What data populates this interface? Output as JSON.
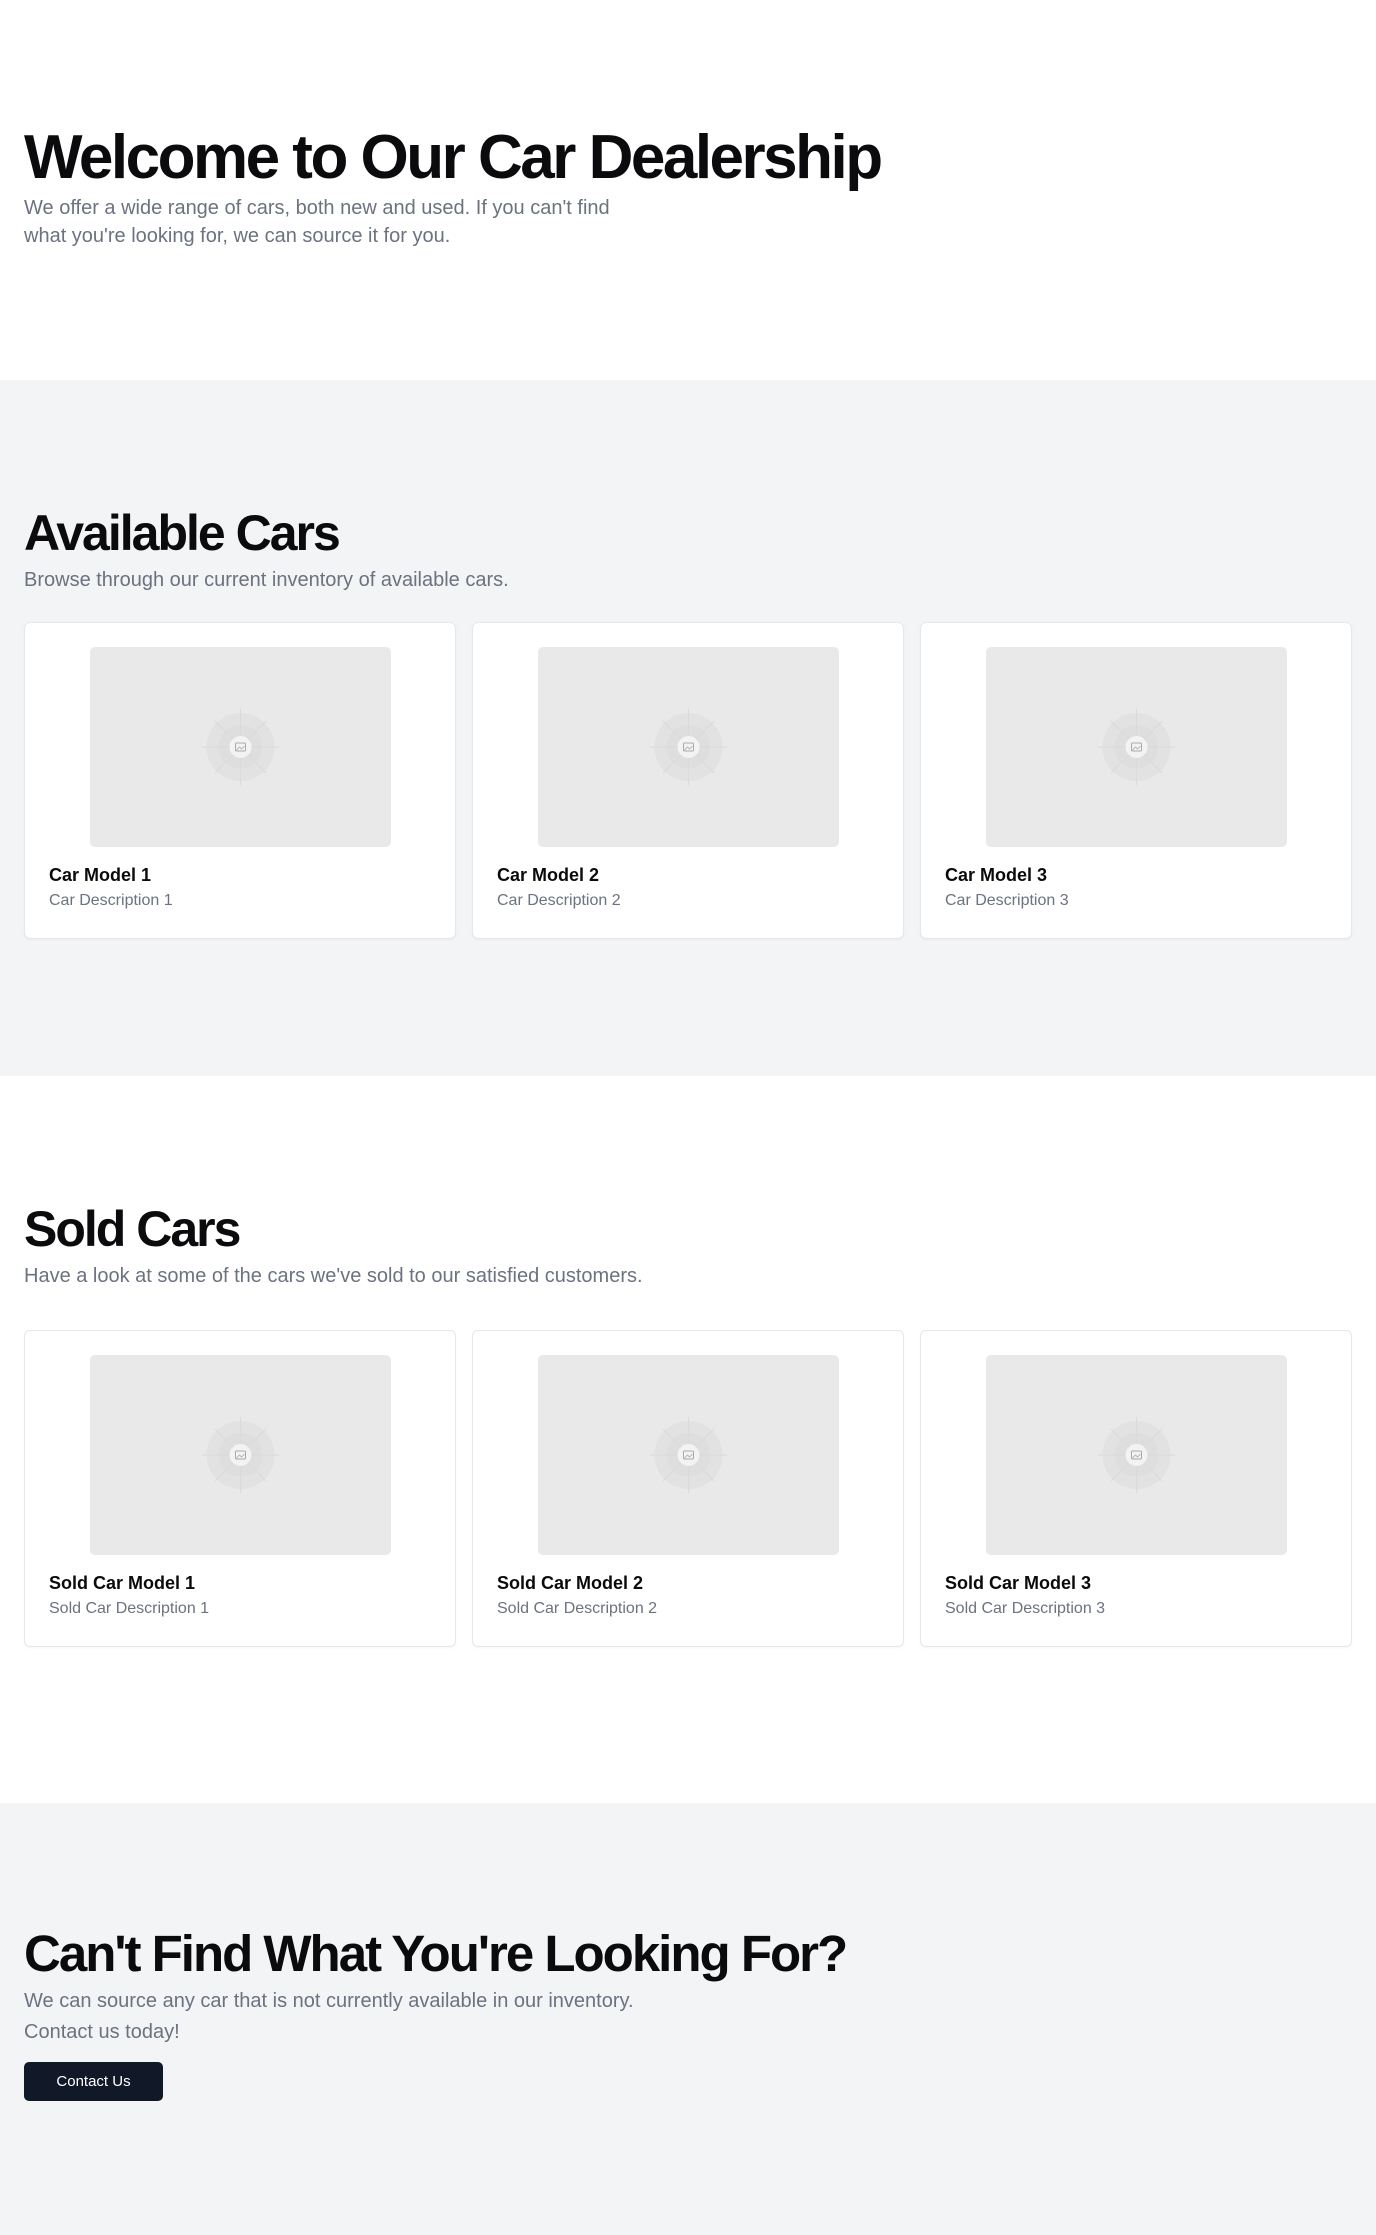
{
  "hero": {
    "title": "Welcome to Our Car Dealership",
    "subtitle": "We offer a wide range of cars, both new and used. If you can't find what you're looking for, we can source it for you."
  },
  "available": {
    "title": "Available Cars",
    "subtitle": "Browse through our current inventory of available cars.",
    "cards": [
      {
        "name": "Car Model 1",
        "desc": "Car Description 1",
        "icon": "image-placeholder-icon"
      },
      {
        "name": "Car Model 2",
        "desc": "Car Description 2",
        "icon": "image-placeholder-icon"
      },
      {
        "name": "Car Model 3",
        "desc": "Car Description 3",
        "icon": "image-placeholder-icon"
      }
    ]
  },
  "sold": {
    "title": "Sold Cars",
    "subtitle": "Have a look at some of the cars we've sold to our satisfied customers.",
    "cards": [
      {
        "name": "Sold Car Model 1",
        "desc": "Sold Car Description 1",
        "icon": "image-placeholder-icon"
      },
      {
        "name": "Sold Car Model 2",
        "desc": "Sold Car Description 2",
        "icon": "image-placeholder-icon"
      },
      {
        "name": "Sold Car Model 3",
        "desc": "Sold Car Description 3",
        "icon": "image-placeholder-icon"
      }
    ]
  },
  "contact": {
    "title": "Can't Find What You're Looking For?",
    "subtitle": "We can source any car that is not currently available in our inventory. Contact us today!",
    "button_label": "Contact Us"
  },
  "colors": {
    "heading": "#0b0b0d",
    "muted_text": "#6b7280",
    "section_alt_bg": "#f3f4f6",
    "placeholder_bg": "#e9e9e9",
    "button_bg": "#111827",
    "button_text": "#ffffff"
  }
}
